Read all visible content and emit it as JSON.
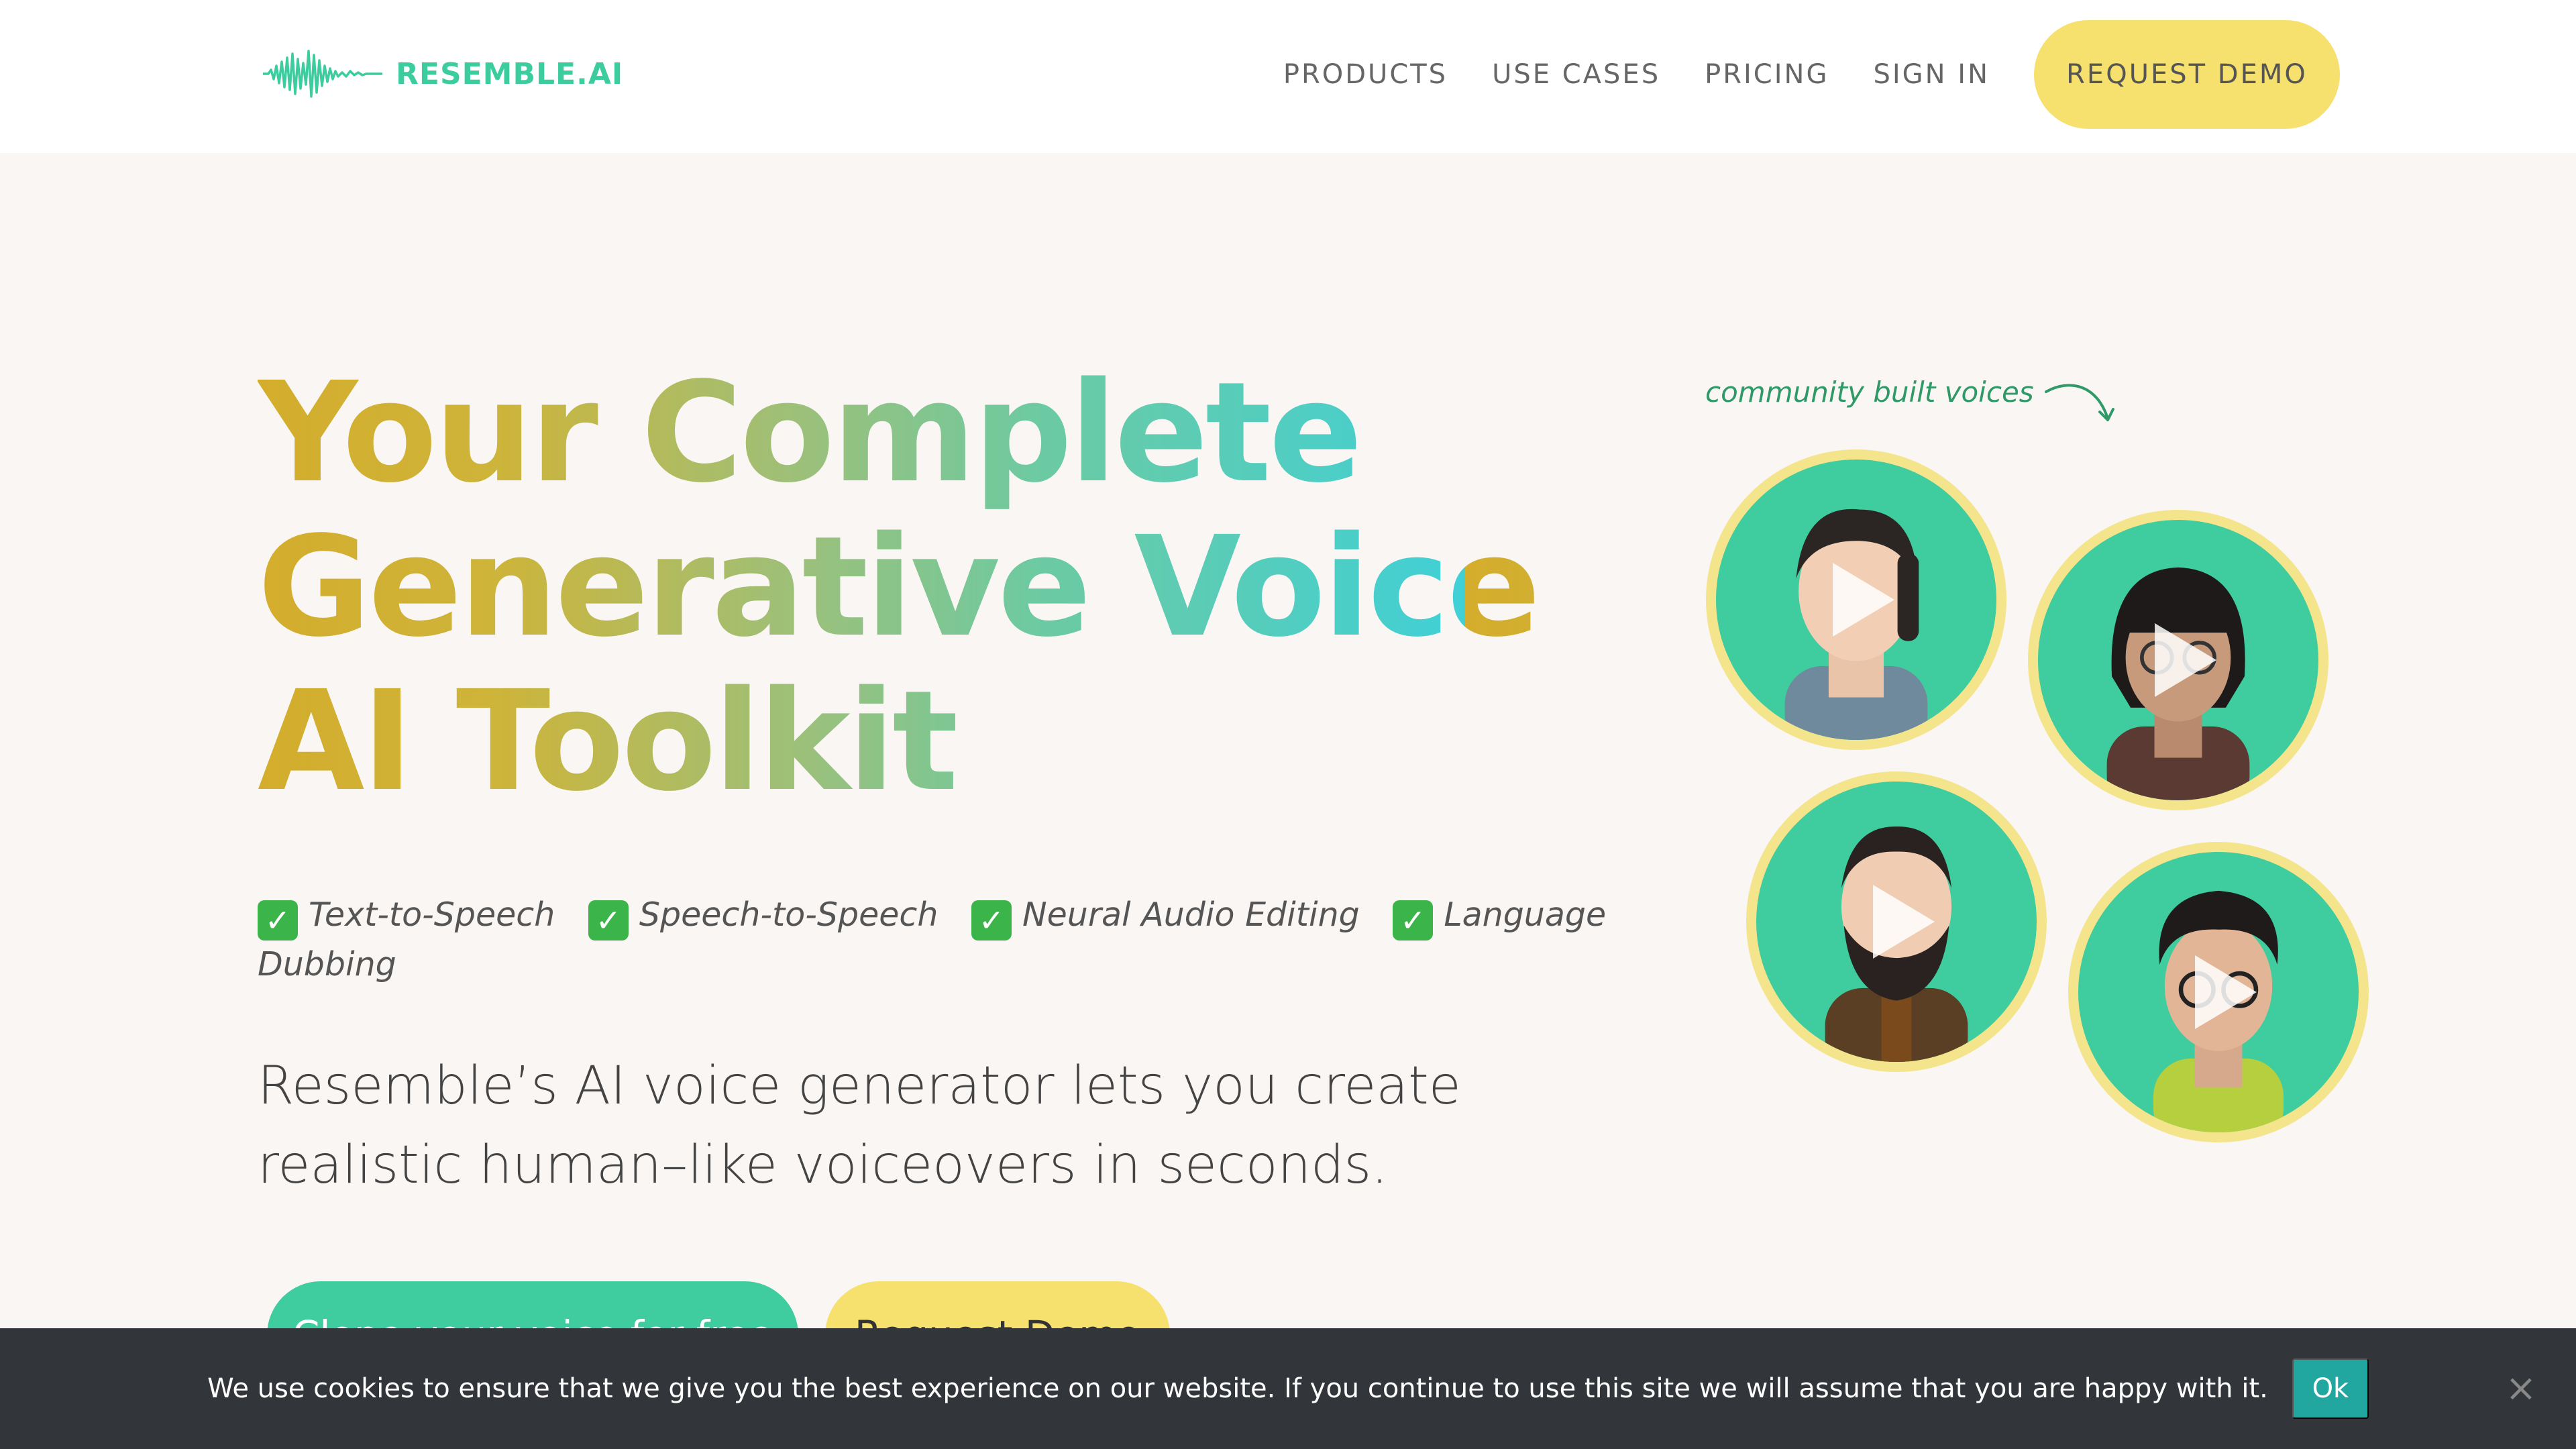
{
  "brand": {
    "name": "RESEMBLE.AI",
    "accent_color": "#3ccc9e",
    "yellow": "#f6e06e",
    "logo_icon": "waveform-icon"
  },
  "nav": {
    "items": [
      {
        "label": "PRODUCTS"
      },
      {
        "label": "USE CASES"
      },
      {
        "label": "PRICING"
      },
      {
        "label": "SIGN IN"
      }
    ],
    "cta_label": "REQUEST DEMO"
  },
  "hero": {
    "headline_lines": [
      "Your Complete",
      "Generative Voice",
      "AI Toolkit"
    ],
    "features": [
      {
        "icon": "checkmark-icon",
        "label": "Text-to-Speech"
      },
      {
        "icon": "checkmark-icon",
        "label": "Speech-to-Speech"
      },
      {
        "icon": "checkmark-icon",
        "label": "Neural Audio Editing"
      },
      {
        "icon": "checkmark-icon",
        "label": "Language Dubbing"
      }
    ],
    "description": "Resemble’s AI voice generator lets you create realistic human–like voiceovers in seconds.",
    "primary_button": "Clone your voice for free",
    "secondary_button": "Request Demo"
  },
  "voices": {
    "note": "community built voices",
    "avatars": [
      {
        "icon": "play-icon"
      },
      {
        "icon": "play-icon"
      },
      {
        "icon": "play-icon"
      },
      {
        "icon": "play-icon"
      }
    ]
  },
  "cookie_bar": {
    "message": "We use cookies to ensure that we give you the best experience on our website. If you continue to use this site we will assume that you are happy with it.",
    "ok_label": "Ok",
    "close_icon": "close-icon"
  }
}
